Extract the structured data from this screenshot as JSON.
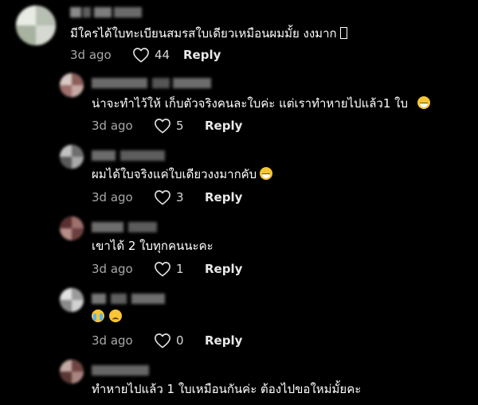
{
  "comments": [
    {
      "text": "มีใครได้ใบทะเบียนสมรสใบเดียวเหมือนผมมั้ย งงมาก",
      "trailing_icon": "missing-glyph-icon",
      "date": "3d ago",
      "likes": "44",
      "reply_label": "Reply"
    },
    {
      "text": "น่าจะทำไว้ให้ เก็บตัวจริงคนละใบค่ะ แต่เราทำหายไปแล้ว1 ใบ",
      "trailing_icon": "grinning-face-icon",
      "date": "3d ago",
      "likes": "5",
      "reply_label": "Reply"
    },
    {
      "text": "ผมได้ใบจริงแค่ใบเดียวงงมากคับ",
      "trailing_icon": "grinning-face-icon",
      "date": "3d ago",
      "likes": "3",
      "reply_label": "Reply"
    },
    {
      "text": "เขาได้ 2 ใบทุกคนนะคะ",
      "date": "3d ago",
      "likes": "1",
      "reply_label": "Reply"
    },
    {
      "text": "",
      "emoji_icons": [
        "loudly-crying-face-icon",
        "sad-face-icon"
      ],
      "date": "3d ago",
      "likes": "0",
      "reply_label": "Reply"
    },
    {
      "text": "ทำหายไปแล้ว 1 ใบเหมือนกันค่ะ ต้องไปขอใหม่มั้ยคะ"
    }
  ],
  "colors": {
    "background": "#000000",
    "text": "#ffffff",
    "meta": "#a8a8a8",
    "reply": "#e9e9e9",
    "blurred_avatar_1": "#c9cec6",
    "blurred_avatar_2": "#9c6a67",
    "blurred_username": "#6f6f6f"
  }
}
